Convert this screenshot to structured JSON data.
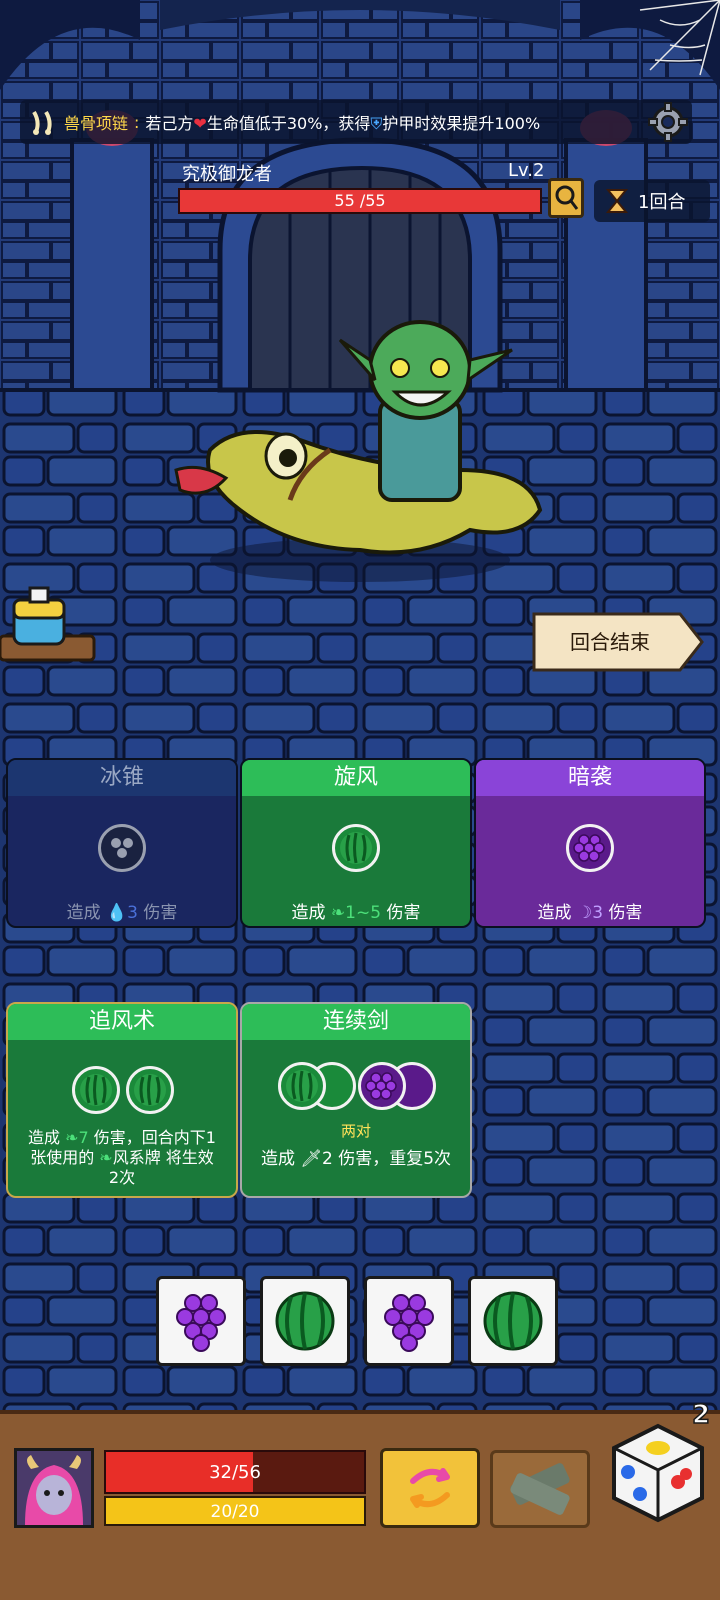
{
  "banner": {
    "relic_name": "兽骨项链",
    "colon": ":",
    "text_part1": "若己方",
    "text_part2": "生命值低于30%，获得",
    "text_part3": "护甲时效果提升100%"
  },
  "enemy": {
    "name": "究极御龙者",
    "level": "Lv.2",
    "hp_text": "55 /55",
    "hp_fraction": 1.0
  },
  "round": {
    "label": "1回合"
  },
  "end_turn": {
    "label": "回合结束"
  },
  "cards": {
    "ice_cone": {
      "title": "冰锥",
      "desc_pre": "造成",
      "value": "3",
      "desc_post": "伤害"
    },
    "whirlwind": {
      "title": "旋风",
      "desc_pre": "造成",
      "value": "1~5",
      "desc_post": "伤害"
    },
    "ambush": {
      "title": "暗袭",
      "desc_pre": "造成",
      "value": "3",
      "desc_post": "伤害"
    },
    "chase_wind": {
      "title": "追风术",
      "line1_pre": "造成",
      "value": "7",
      "line1_post": "伤害，回合内下1",
      "line2_pre": "张使用的",
      "line2_post": "风系牌 将生效",
      "line3": "2次"
    },
    "combo_sword": {
      "title": "连续剑",
      "pair_label": "两对",
      "desc_pre": "造成",
      "value": "2",
      "desc_post": "伤害，重复5次"
    }
  },
  "dice_pool": [
    "grape",
    "watermelon",
    "grape",
    "watermelon"
  ],
  "player": {
    "hp_text": "32/56",
    "hp_fraction": 0.571,
    "armor_text": "20/20",
    "armor_fraction": 1.0
  },
  "reroll_count": "2",
  "colors": {
    "green_card": "#2dbd58",
    "purple_card": "#8a44d8",
    "ice_card": "#1c3670"
  }
}
